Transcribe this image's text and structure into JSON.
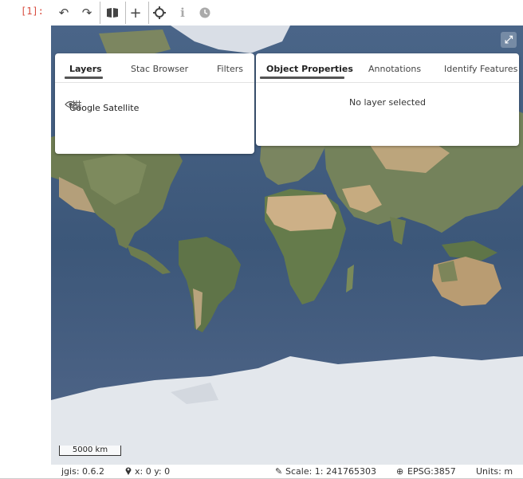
{
  "cell": {
    "prompt": "[1]:"
  },
  "toolbar": {
    "buttons": [
      {
        "name": "undo-button",
        "icon": "undo-icon",
        "glyph": "↶"
      },
      {
        "name": "redo-button",
        "icon": "redo-icon",
        "glyph": "↷"
      },
      {
        "name": "open-book-button",
        "icon": "book-icon",
        "glyph": "📖"
      },
      {
        "name": "add-button",
        "icon": "plus-icon",
        "glyph": "+"
      },
      {
        "name": "locate-button",
        "icon": "crosshair-icon",
        "glyph": "⌖"
      },
      {
        "name": "info-button",
        "icon": "info-icon",
        "glyph": "i"
      },
      {
        "name": "history-button",
        "icon": "clock-icon",
        "glyph": "⏲"
      }
    ]
  },
  "left_panel": {
    "tabs": [
      "Layers",
      "Stac Browser",
      "Filters"
    ],
    "active_tab": "Layers",
    "layers": [
      {
        "label": "Google Satellite",
        "visible": true
      }
    ]
  },
  "right_panel": {
    "tabs": [
      "Object Properties",
      "Annotations",
      "Identify Features"
    ],
    "active_tab": "Object Properties",
    "empty_message": "No layer selected"
  },
  "map": {
    "scale_bar_label": "5000 km"
  },
  "status": {
    "version": "jgis: 0.6.2",
    "coords": "x: 0 y: 0",
    "scale": "Scale: 1: 241765303",
    "crs": "EPSG:3857",
    "units": "Units: m"
  },
  "colors": {
    "ocean": "#3f5a7d",
    "land": "#6f7d55",
    "desert": "#c9ad84",
    "ice": "#e6e9ee",
    "prompt": "#d84b3e"
  }
}
